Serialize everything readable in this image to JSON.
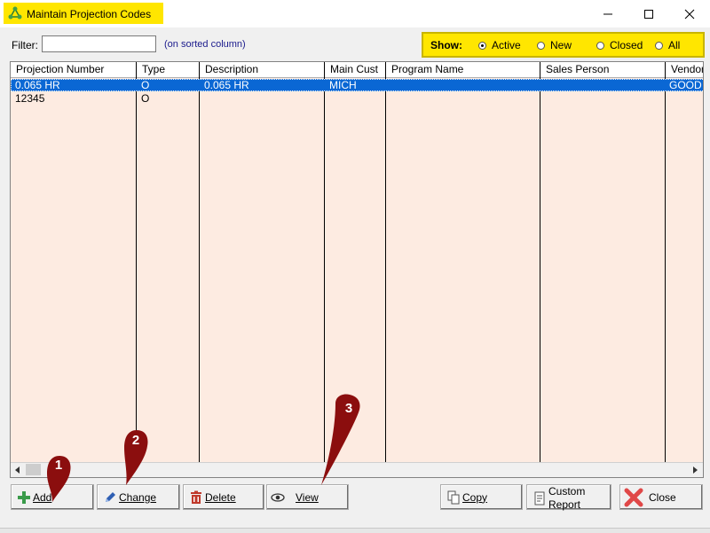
{
  "window": {
    "title": "Maintain Projection Codes",
    "minimize_glyph": "—",
    "maximize_glyph": "☐",
    "close_glyph": "✕"
  },
  "filter": {
    "label": "Filter:",
    "value": "",
    "hint": "(on sorted column)"
  },
  "show": {
    "label": "Show:",
    "options": [
      {
        "label": "Active",
        "selected": true
      },
      {
        "label": "New",
        "selected": false
      },
      {
        "label": "Closed",
        "selected": false
      },
      {
        "label": "All",
        "selected": false
      }
    ]
  },
  "grid": {
    "columns": [
      "Projection Number",
      "Type",
      "Description",
      "Main Cust",
      "Program Name",
      "Sales Person",
      "Vendor"
    ],
    "rows": [
      {
        "cells": [
          "0.065 HR",
          "O",
          "0.065 HR",
          "MICH",
          "",
          "",
          "GOOD"
        ],
        "selected": true
      },
      {
        "cells": [
          "12345",
          "O",
          "",
          "",
          "",
          "",
          ""
        ],
        "selected": false
      }
    ]
  },
  "buttons": {
    "add": "Add",
    "change": "Change",
    "delete": "Delete",
    "view": "View",
    "copy": "Copy",
    "custom_report_1": "Custom",
    "custom_report_2": "Report",
    "close": "Close"
  },
  "callouts": [
    "1",
    "2",
    "3"
  ],
  "colors": {
    "highlight": "#ffe600",
    "selection": "#0a67d4",
    "grid_bg": "#fdebe1",
    "callout": "#8b0e0e"
  }
}
